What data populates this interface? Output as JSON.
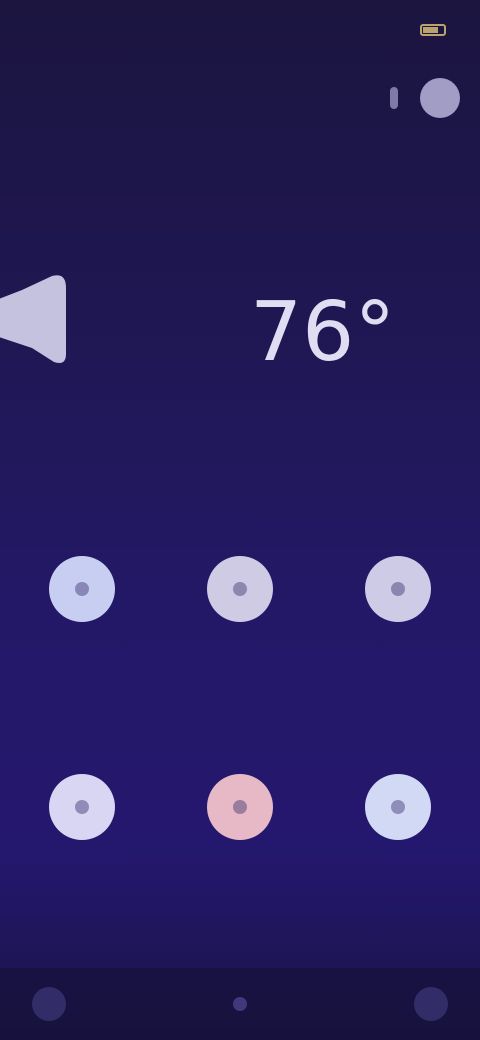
{
  "status_bar": {
    "time": "",
    "signal": ""
  },
  "header": {
    "location": "",
    "headline": "",
    "subtitle": ""
  },
  "weather": {
    "temperature": "76°",
    "condition_caption": "",
    "range_caption": ""
  },
  "tiles": [
    {
      "label": "",
      "color": "#c8cdf2",
      "icon": "circle-icon"
    },
    {
      "label": "",
      "color": "#cfcbe4",
      "icon": "circle-icon"
    },
    {
      "label": "",
      "color": "#cdcbe6",
      "icon": "circle-icon"
    },
    {
      "label": "",
      "color": "#d8d6f2",
      "icon": "circle-icon"
    },
    {
      "label": "",
      "color": "#e7b8c6",
      "icon": "circle-icon"
    },
    {
      "label": "",
      "color": "#d2d9f4",
      "icon": "circle-icon"
    }
  ],
  "colors": {
    "background": "#221766",
    "accent": "#f0d37a"
  }
}
